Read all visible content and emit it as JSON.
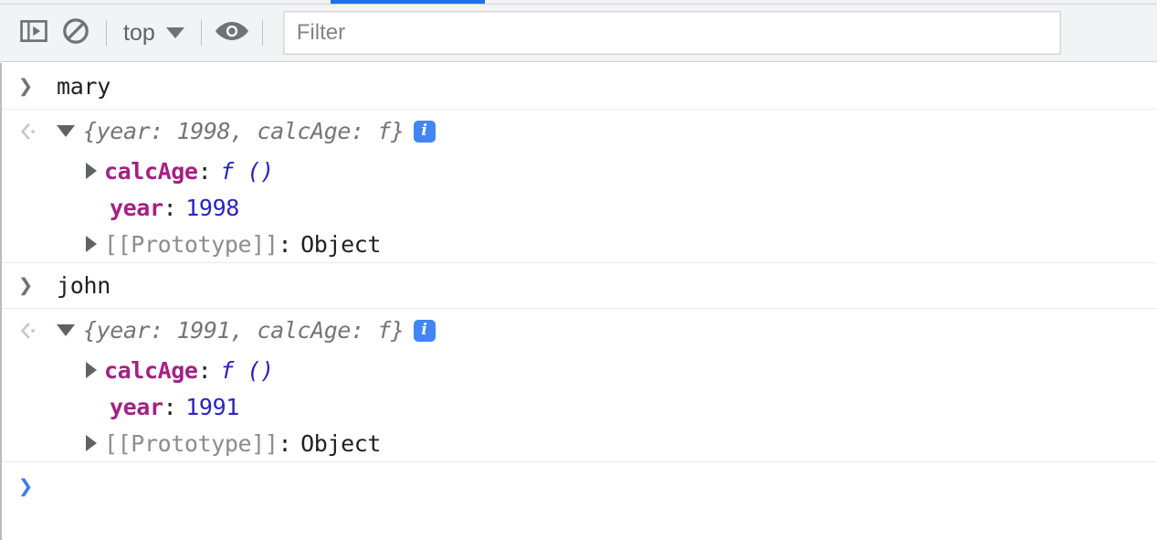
{
  "window": {
    "accent_color": "#1a73e8",
    "toolbar_bg": "#f1f3f4"
  },
  "toolbar": {
    "sidebar_toggle_icon": "console-sidebar-icon",
    "clear_console_icon": "clear-console-icon",
    "context_selector": {
      "label": "top",
      "caret_icon": "chevron-down-icon"
    },
    "live_expression_icon": "eye-icon",
    "filter": {
      "placeholder": "Filter",
      "value": ""
    }
  },
  "console": {
    "entries": [
      {
        "kind": "input",
        "gutter_icon": "prompt-arrow-icon",
        "text": "mary"
      },
      {
        "kind": "output",
        "gutter_icon": "result-arrow-icon",
        "preview_open": "{year: ",
        "preview_number": "1998",
        "preview_close": ", calcAge: f}",
        "info_badge": "i",
        "disclosure_icon": "triangle-down-icon",
        "properties": [
          {
            "disclosure_icon": "triangle-right-icon",
            "expandable": true,
            "name": "calcAge",
            "colon": ":",
            "value": "f ()",
            "value_kind": "function"
          },
          {
            "expandable": false,
            "name": "year",
            "colon": ":",
            "value": "1998",
            "value_kind": "number"
          },
          {
            "disclosure_icon": "triangle-right-icon",
            "expandable": true,
            "name": "[[Prototype]]",
            "colon": ":",
            "value": "Object",
            "value_kind": "plain"
          }
        ]
      },
      {
        "kind": "input",
        "gutter_icon": "prompt-arrow-icon",
        "text": "john"
      },
      {
        "kind": "output",
        "gutter_icon": "result-arrow-icon",
        "preview_open": "{year: ",
        "preview_number": "1991",
        "preview_close": ", calcAge: f}",
        "info_badge": "i",
        "disclosure_icon": "triangle-down-icon",
        "properties": [
          {
            "disclosure_icon": "triangle-right-icon",
            "expandable": true,
            "name": "calcAge",
            "colon": ":",
            "value": "f ()",
            "value_kind": "function"
          },
          {
            "expandable": false,
            "name": "year",
            "colon": ":",
            "value": "1991",
            "value_kind": "number"
          },
          {
            "disclosure_icon": "triangle-right-icon",
            "expandable": true,
            "name": "[[Prototype]]",
            "colon": ":",
            "value": "Object",
            "value_kind": "plain"
          }
        ]
      }
    ],
    "prompt": {
      "gutter_icon": "prompt-arrow-icon",
      "value": ""
    }
  },
  "colors": {
    "property_name": "#a52184",
    "number_value": "#2a23c4",
    "preview_text": "#757575",
    "info_badge_bg": "#4285f4",
    "prompt_blue": "#3b7ded"
  }
}
